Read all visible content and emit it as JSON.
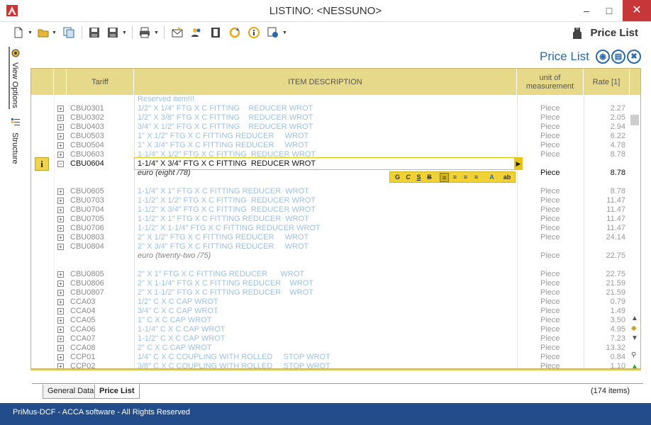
{
  "window": {
    "title": "LISTINO: <NESSUNO>",
    "min": "–",
    "max": "□",
    "close": "✕"
  },
  "header": {
    "label": "Price List"
  },
  "subheader": {
    "label": "Price List"
  },
  "side_tabs": [
    {
      "label": "View Options"
    },
    {
      "label": "Structure"
    }
  ],
  "grid": {
    "columns": {
      "tariff": "Tariff",
      "description": "ITEM DESCRIPTION",
      "unit": "unit of measurement",
      "rate": "Rate [1]"
    },
    "reserved": "Reserved item!!!",
    "rows": [
      {
        "code": "CBU0301",
        "desc": "1/2\" X 1/4\" FTG X C FITTING    REDUCER WROT",
        "unit": "Piece",
        "rate": "2.27"
      },
      {
        "code": "CBU0302",
        "desc": "1/2\" X 3/8\" FTG X C FITTING    REDUCER WROT",
        "unit": "Piece",
        "rate": "2.05"
      },
      {
        "code": "CBU0403",
        "desc": "3/4\" X 1/2\" FTG X C FITTING    REDUCER WROT",
        "unit": "Piece",
        "rate": "2.94"
      },
      {
        "code": "CBU0503",
        "desc": "1\" X 1/2\" FTG X C FITTING REDUCER     WROT",
        "unit": "Piece",
        "rate": "6.22"
      },
      {
        "code": "CBU0504",
        "desc": "1\" X 3/4\" FTG X C FITTING REDUCER     WROT",
        "unit": "Piece",
        "rate": "4.78"
      },
      {
        "code": "CBU0603",
        "desc": "1-1/4\" X 1/2\" FTG X C FITTING  REDUCER WROT",
        "unit": "Piece",
        "rate": "8.78"
      }
    ],
    "selected": {
      "code": "CBU0604",
      "desc": "1-1/4\" X 3/4\" FTG X C FITTING  REDUCER WROT",
      "euro": "euro (eight /78)",
      "unit": "Piece",
      "rate": "8.78"
    },
    "rows2": [
      {
        "code": "CBU0605",
        "desc": "1-1/4\" X 1\" FTG X C FITTING REDUCER  WROT",
        "unit": "Piece",
        "rate": "8.78"
      },
      {
        "code": "CBU0703",
        "desc": "1-1/2\" X 1/2\" FTG X C FITTING  REDUCER WROT",
        "unit": "Piece",
        "rate": "11.47"
      },
      {
        "code": "CBU0704",
        "desc": "1-1/2\" X 3/4\" FTG X C FITTING  REDUCER WROT",
        "unit": "Piece",
        "rate": "11.47"
      },
      {
        "code": "CBU0705",
        "desc": "1-1/2\" X 1\" FTG X C FITTING REDUCER  WROT",
        "unit": "Piece",
        "rate": "11.47"
      },
      {
        "code": "CBU0706",
        "desc": "1-1/2\" X 1-1/4\" FTG X C FITTING REDUCER WROT",
        "unit": "Piece",
        "rate": "11.47"
      },
      {
        "code": "CBU0803",
        "desc": "2\" X 1/2\" FTG X C FITTING REDUCER     WROT",
        "unit": "Piece",
        "rate": "24.14"
      },
      {
        "code": "CBU0804",
        "desc": "2\" X 3/4\" FTG X C FITTING REDUCER     WROT",
        "unit": "",
        "rate": ""
      }
    ],
    "euro2": "euro (twenty-two /75)",
    "euro2_unit": "Piece",
    "euro2_rate": "22.75",
    "rows3": [
      {
        "code": "CBU0805",
        "desc": "2\" X 1\" FTG X C FITTING REDUCER      WROT",
        "unit": "Piece",
        "rate": "22.75"
      },
      {
        "code": "CBU0806",
        "desc": "2\" X 1-1/4\" FTG X C FITTING REDUCER    WROT",
        "unit": "Piece",
        "rate": "21.59"
      },
      {
        "code": "CBU0807",
        "desc": "2\" X 1-1/2\" FTG X C FITTING REDUCER    WROT",
        "unit": "Piece",
        "rate": "21.59"
      },
      {
        "code": "CCA03",
        "desc": "1/2\" C X C CAP WROT",
        "unit": "Piece",
        "rate": "0.79"
      },
      {
        "code": "CCA04",
        "desc": "3/4\" C X C CAP WROT",
        "unit": "Piece",
        "rate": "1.49"
      },
      {
        "code": "CCA05",
        "desc": "1\" C X C CAP WROT",
        "unit": "Piece",
        "rate": "3.50"
      },
      {
        "code": "CCA06",
        "desc": "1-1/4\" C X C CAP WROT",
        "unit": "Piece",
        "rate": "4.95"
      },
      {
        "code": "CCA07",
        "desc": "1-1/2\" C X C CAP WROT",
        "unit": "Piece",
        "rate": "7.23"
      },
      {
        "code": "CCA08",
        "desc": "2\" C X C CAP WROT",
        "unit": "Piece",
        "rate": "13.32"
      },
      {
        "code": "CCP01",
        "desc": "1/4\" C X C COUPLING WITH ROLLED     STOP WROT",
        "unit": "Piece",
        "rate": "0.84"
      },
      {
        "code": "CCP02",
        "desc": "3/8\" C X C COUPLING WITH ROLLED     STOP WROT",
        "unit": "Piece",
        "rate": "1.10"
      }
    ]
  },
  "format_buttons": [
    "G",
    "C",
    "S",
    "B",
    "≡",
    "≡",
    "≡",
    "≡",
    "A",
    "ab"
  ],
  "tabs": {
    "general": "General Data",
    "price": "Price List"
  },
  "items_count": "(174 items)",
  "status": "PriMus-DCF - ACCA software - All Rights Reserved",
  "colors": {
    "accent": "#2d6aa8",
    "status_bar": "#234d8a",
    "header": "#e7d98a",
    "close": "#c7373a"
  }
}
